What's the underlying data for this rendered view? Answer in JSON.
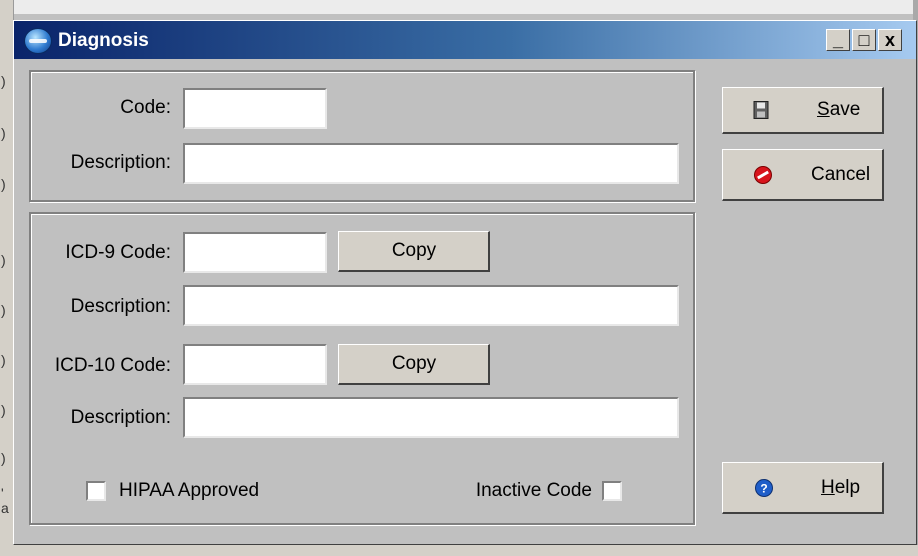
{
  "window": {
    "title": "Diagnosis"
  },
  "title_controls": {
    "minimize": "_",
    "maximize": "□",
    "close": "x"
  },
  "code_section": {
    "code_label": "Code:",
    "code_value": "",
    "description_label": "Description:",
    "description_value": ""
  },
  "icd_section": {
    "icd9_label": "ICD-9 Code:",
    "icd9_value": "",
    "icd9_copy": "Copy",
    "icd9_desc_label": "Description:",
    "icd9_desc_value": "",
    "icd10_label": "ICD-10 Code:",
    "icd10_value": "",
    "icd10_copy": "Copy",
    "icd10_desc_label": "Description:",
    "icd10_desc_value": "",
    "hipaa_label": "HIPAA Approved",
    "hipaa_checked": false,
    "inactive_label": "Inactive Code",
    "inactive_checked": false
  },
  "buttons": {
    "save_first": "S",
    "save_rest": "ave",
    "cancel": "Cancel",
    "help_first": "H",
    "help_rest": "elp"
  },
  "background": {
    "edge_marks": [
      ")",
      ")",
      ")",
      ")",
      ")",
      ")",
      ")",
      ")",
      "'",
      "a"
    ]
  },
  "colors": {
    "title_start": "#0a246a",
    "title_end": "#a6caf0",
    "face": "#c0c0c0"
  }
}
